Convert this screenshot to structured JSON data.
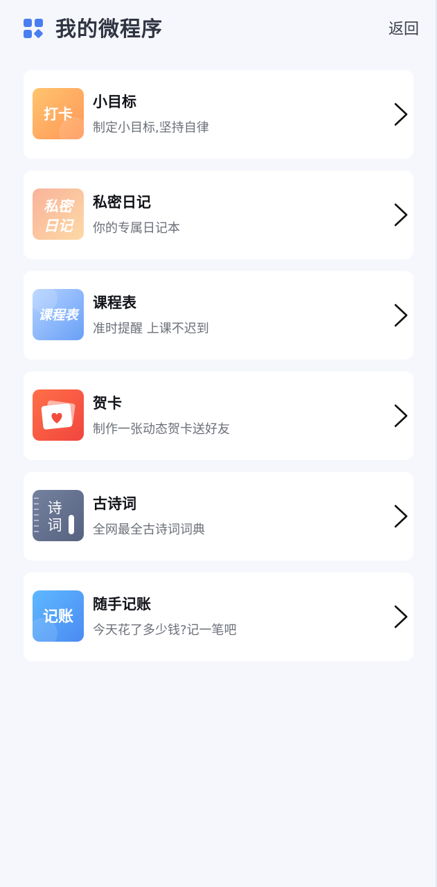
{
  "header": {
    "title": "我的微程序",
    "back_label": "返回",
    "icon": "grid-apps-icon",
    "accent_color": "#4a7ef0"
  },
  "items": [
    {
      "title": "小目标",
      "desc": "制定小目标,坚持自律",
      "icon_text": "打卡",
      "icon": "punch-card-icon",
      "colors": [
        "#ffbe6a",
        "#ff9a5a"
      ]
    },
    {
      "title": "私密日记",
      "desc": "你的专属日记本",
      "icon_text_line1": "私密",
      "icon_text_line2": "日记",
      "icon": "diary-icon",
      "colors": [
        "#fbb89a",
        "#fcd8a6"
      ]
    },
    {
      "title": "课程表",
      "desc": "准时提醒 上课不迟到",
      "icon_text": "课程表",
      "icon": "schedule-icon",
      "colors": [
        "#a9cbff",
        "#6ea3f8"
      ]
    },
    {
      "title": "贺卡",
      "desc": "制作一张动态贺卡送好友",
      "icon": "greeting-card-icon",
      "colors": [
        "#ff6a4a",
        "#f24c3c"
      ]
    },
    {
      "title": "古诗词",
      "desc": "全网最全古诗词词典",
      "icon_text_line1": "诗",
      "icon_text_line2": "词",
      "icon": "poetry-book-icon",
      "colors": [
        "#6e7b9d",
        "#5b6789"
      ]
    },
    {
      "title": "随手记账",
      "desc": "今天花了多少钱?记一笔吧",
      "icon_text": "记账",
      "icon": "bookkeeping-icon",
      "colors": [
        "#5db3ff",
        "#4d8ff3"
      ]
    }
  ]
}
